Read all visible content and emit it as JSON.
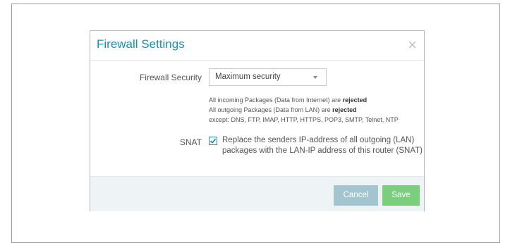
{
  "dialog": {
    "title": "Firewall Settings",
    "close_symbol": "×"
  },
  "firewall_security": {
    "label": "Firewall Security",
    "selected": "Maximum security"
  },
  "description": {
    "line1_prefix": "All incoming Packages (Data from Internet) are ",
    "line1_bold": "rejected",
    "line2_prefix": "All outgoing Packages (Data from LAN) are ",
    "line2_bold": "rejected",
    "line3": "except: DNS, FTP, IMAP, HTTP, HTTPS, POP3, SMTP, Telnet, NTP"
  },
  "snat": {
    "label": "SNAT",
    "checked": true,
    "text_line1": "Replace the senders IP-address of all outgoing (LAN)",
    "text_line2": "packages with the LAN-IP address of this router (SNAT)"
  },
  "buttons": {
    "cancel": "Cancel",
    "save": "Save"
  },
  "colors": {
    "title": "#1a8fb5",
    "cancel_bg": "#a3c5cf",
    "save_bg": "#79cf7e",
    "footer_bg": "#eef3f6"
  },
  "icons": {
    "close": "close-icon",
    "checkbox_check": "check-icon",
    "select_caret": "caret-down-icon"
  }
}
